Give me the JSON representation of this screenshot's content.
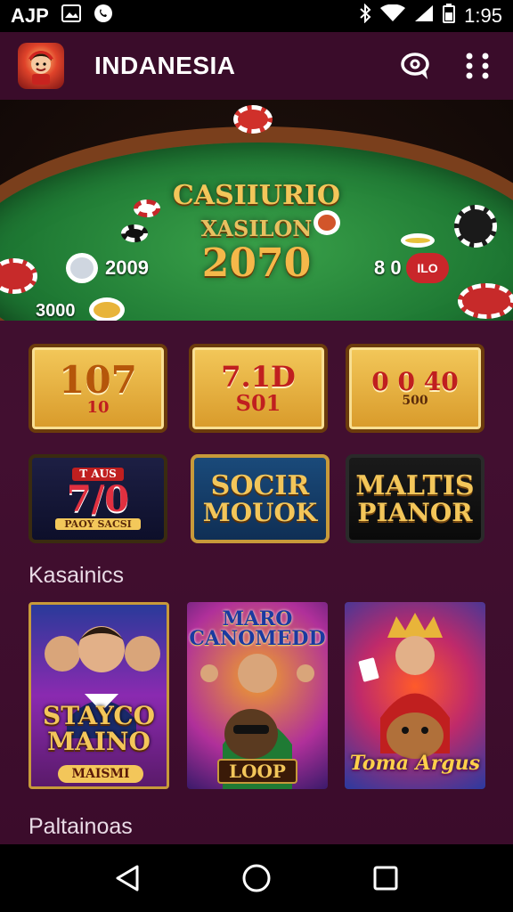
{
  "status_bar": {
    "carrier": "AJP",
    "time": "1:95",
    "icons": [
      "image-icon",
      "whatsapp-icon",
      "bluetooth-icon",
      "wifi-icon",
      "signal-icon",
      "battery-icon"
    ]
  },
  "app_bar": {
    "title": "INDANESIA",
    "actions": [
      "chat-icon",
      "more-vert-icon"
    ]
  },
  "banner": {
    "title_line1": "CASIIURIO",
    "title_line2": "XASILON",
    "title_line3": "2070",
    "left_value": "2009",
    "right_value": "8 0",
    "pill_text": "ILO",
    "bottom_left_value": "3000"
  },
  "tiles": [
    {
      "main": "107",
      "sub": "10"
    },
    {
      "main": "7.1D",
      "sub": "S01"
    },
    {
      "main": "0 0 40",
      "sub": "500"
    },
    {
      "main": "7/0",
      "sub": "PAOY SACSI",
      "badge": "T AUS"
    },
    {
      "main": "SOCIR",
      "sub": "MOUOK"
    },
    {
      "main": "MALTIS",
      "sub": "PIANOR"
    }
  ],
  "sections": {
    "first_title": "Kasainics",
    "second_title": "Paltainoas"
  },
  "posters": [
    {
      "title": "STAYCO MAINO",
      "badge": "MAISMI"
    },
    {
      "title": "MARO CANOMEDD",
      "badge": "LOOP"
    },
    {
      "title": "Toma Argus",
      "badge": ""
    }
  ],
  "colors": {
    "app_background": "#3a0f2c",
    "accent_gold": "#f3c65a",
    "accent_red": "#c9262a"
  }
}
